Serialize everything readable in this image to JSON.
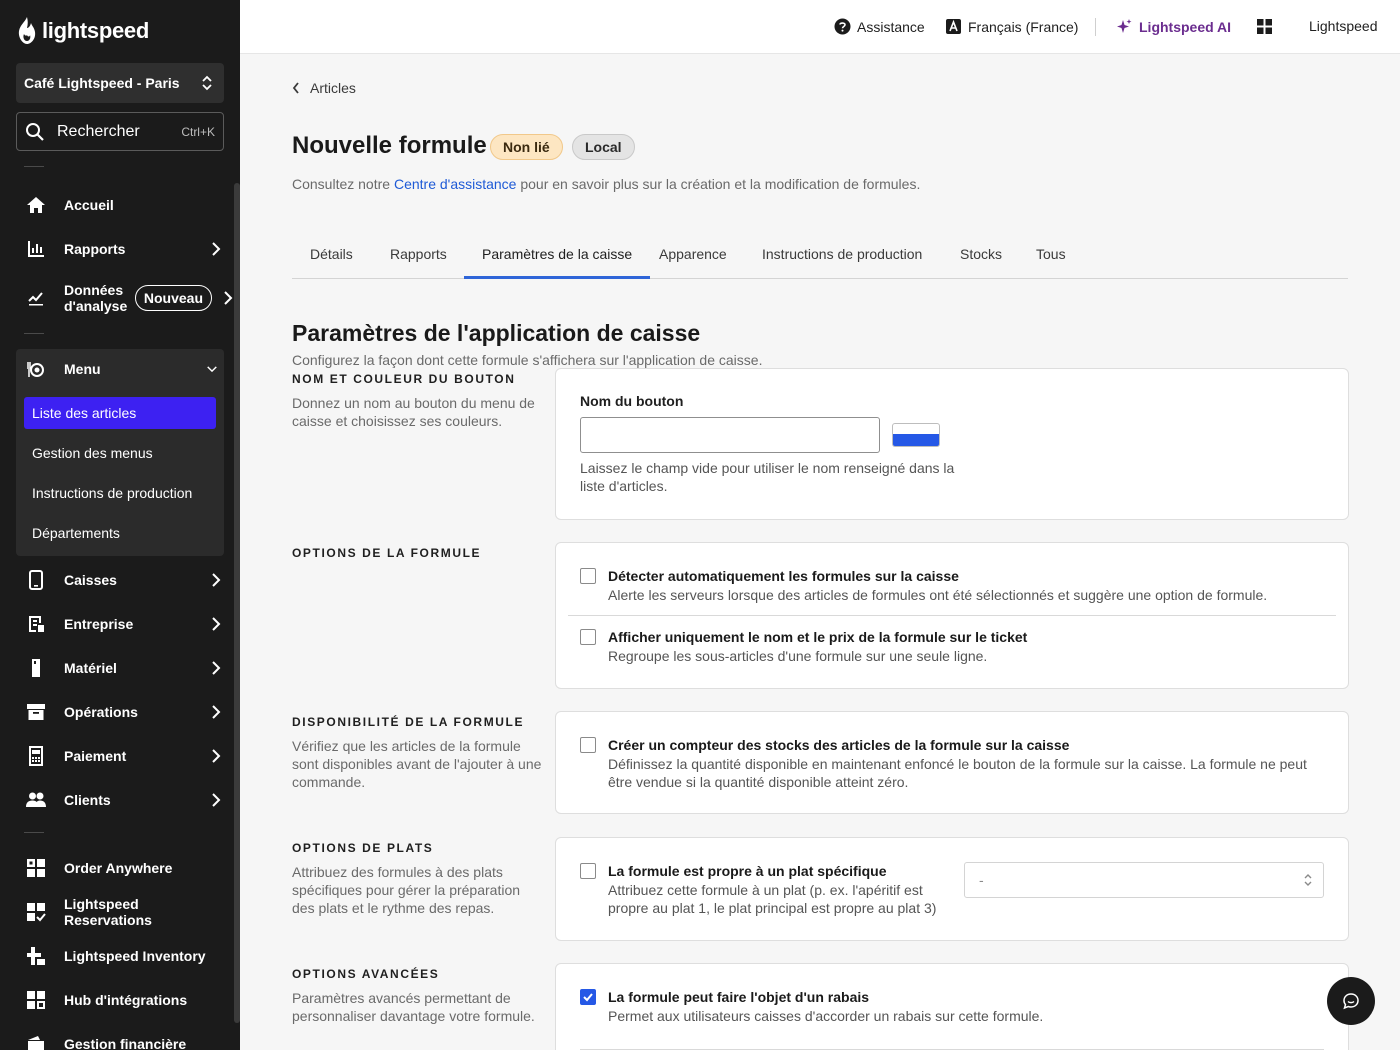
{
  "brand": {
    "logo_text": "lightspeed"
  },
  "sidebar": {
    "store_name": "Café Lightspeed - Paris",
    "search": {
      "label": "Rechercher",
      "shortcut": "Ctrl+K"
    },
    "items": [
      {
        "label": "Accueil",
        "icon": "home-icon"
      },
      {
        "label": "Rapports",
        "icon": "bar-chart-icon"
      },
      {
        "label_line1": "Données",
        "label_line2": "d'analyse",
        "badge": "Nouveau",
        "icon": "analytics-icon"
      },
      {
        "label": "Menu",
        "icon": "menu-dish-icon"
      },
      {
        "label": "Caisses",
        "icon": "tablet-icon"
      },
      {
        "label": "Entreprise",
        "icon": "business-icon"
      },
      {
        "label": "Matériel",
        "icon": "hardware-icon"
      },
      {
        "label": "Opérations",
        "icon": "archive-icon"
      },
      {
        "label": "Paiement",
        "icon": "payment-terminal-icon"
      },
      {
        "label": "Clients",
        "icon": "users-icon"
      },
      {
        "label": "Order Anywhere",
        "icon": "order-anywhere-icon"
      },
      {
        "label": "Lightspeed Reservations",
        "icon": "reservations-icon"
      },
      {
        "label": "Lightspeed Inventory",
        "icon": "inventory-icon"
      },
      {
        "label": "Hub d'intégrations",
        "icon": "integrations-icon"
      },
      {
        "label": "Gestion financière",
        "icon": "finance-icon"
      }
    ],
    "menu_sub": [
      "Liste des articles",
      "Gestion des menus",
      "Instructions de production",
      "Départements"
    ]
  },
  "topbar": {
    "help": "Assistance",
    "language": "Français (France)",
    "ai": "Lightspeed AI",
    "account": "Lightspeed"
  },
  "page": {
    "back_label": "Articles",
    "title": "Nouvelle formule",
    "badge_status": "Non lié",
    "badge_scope": "Local",
    "help_prefix": "Consultez notre ",
    "help_link": "Centre d'assistance",
    "help_suffix": " pour en savoir plus sur la création et la modification de formules.",
    "tabs": [
      "Détails",
      "Rapports",
      "Paramètres de la caisse",
      "Apparence",
      "Instructions de production",
      "Stocks",
      "Tous"
    ],
    "active_tab": "Paramètres de la caisse",
    "section_title": "Paramètres de l'application de caisse",
    "section_desc": "Configurez la façon dont cette formule s'affichera sur l'application de caisse."
  },
  "groups": {
    "button": {
      "title": "NOM ET COULEUR DU BOUTON",
      "desc": "Donnez un nom au bouton du menu de caisse et choisissez ses couleurs.",
      "field_label": "Nom du bouton",
      "field_value": "",
      "hint": "Laissez le champ vide pour utiliser le nom renseigné dans la liste d'articles.",
      "swatch_color": "#2558e6"
    },
    "options": {
      "title": "OPTIONS DE LA FORMULE",
      "opt1_label": "Détecter automatiquement les formules sur la caisse",
      "opt1_desc": "Alerte les serveurs lorsque des articles de formules ont été sélectionnés et suggère une option de formule.",
      "opt1_checked": false,
      "opt2_label": "Afficher uniquement le nom et le prix de la formule sur le ticket",
      "opt2_desc": "Regroupe les sous-articles d'une formule sur une seule ligne.",
      "opt2_checked": false
    },
    "availability": {
      "title": "DISPONIBILITÉ DE LA FORMULE",
      "desc": "Vérifiez que les articles de la formule sont disponibles avant de l'ajouter à une commande.",
      "opt_label": "Créer un compteur des stocks des articles de la formule sur la caisse",
      "opt_desc": "Définissez la quantité disponible en maintenant enfoncé le bouton de la formule sur la caisse. La formule ne peut être vendue si la quantité disponible atteint zéro.",
      "opt_checked": false
    },
    "courses": {
      "title": "OPTIONS DE PLATS",
      "desc": "Attribuez des formules à des plats spécifiques pour gérer la préparation des plats et le rythme des repas.",
      "opt_label": "La formule est propre à un plat spécifique",
      "opt_desc": "Attribuez cette formule à un plat (p. ex. l'apéritif est propre au plat 1, le plat principal est propre au plat 3)",
      "opt_checked": false,
      "select_value": "-"
    },
    "advanced": {
      "title": "OPTIONS AVANCÉES",
      "desc": "Paramètres avancés permettant de personnaliser davantage votre formule.",
      "opt_label": "La formule peut faire l'objet d'un rabais",
      "opt_desc": "Permet aux utilisateurs caisses d'accorder un rabais sur cette formule.",
      "opt_checked": true
    }
  },
  "colors": {
    "accent": "#3d21f2",
    "link": "#1e5ad6",
    "ai": "#6b2d8f",
    "checkbox": "#2558e6"
  }
}
